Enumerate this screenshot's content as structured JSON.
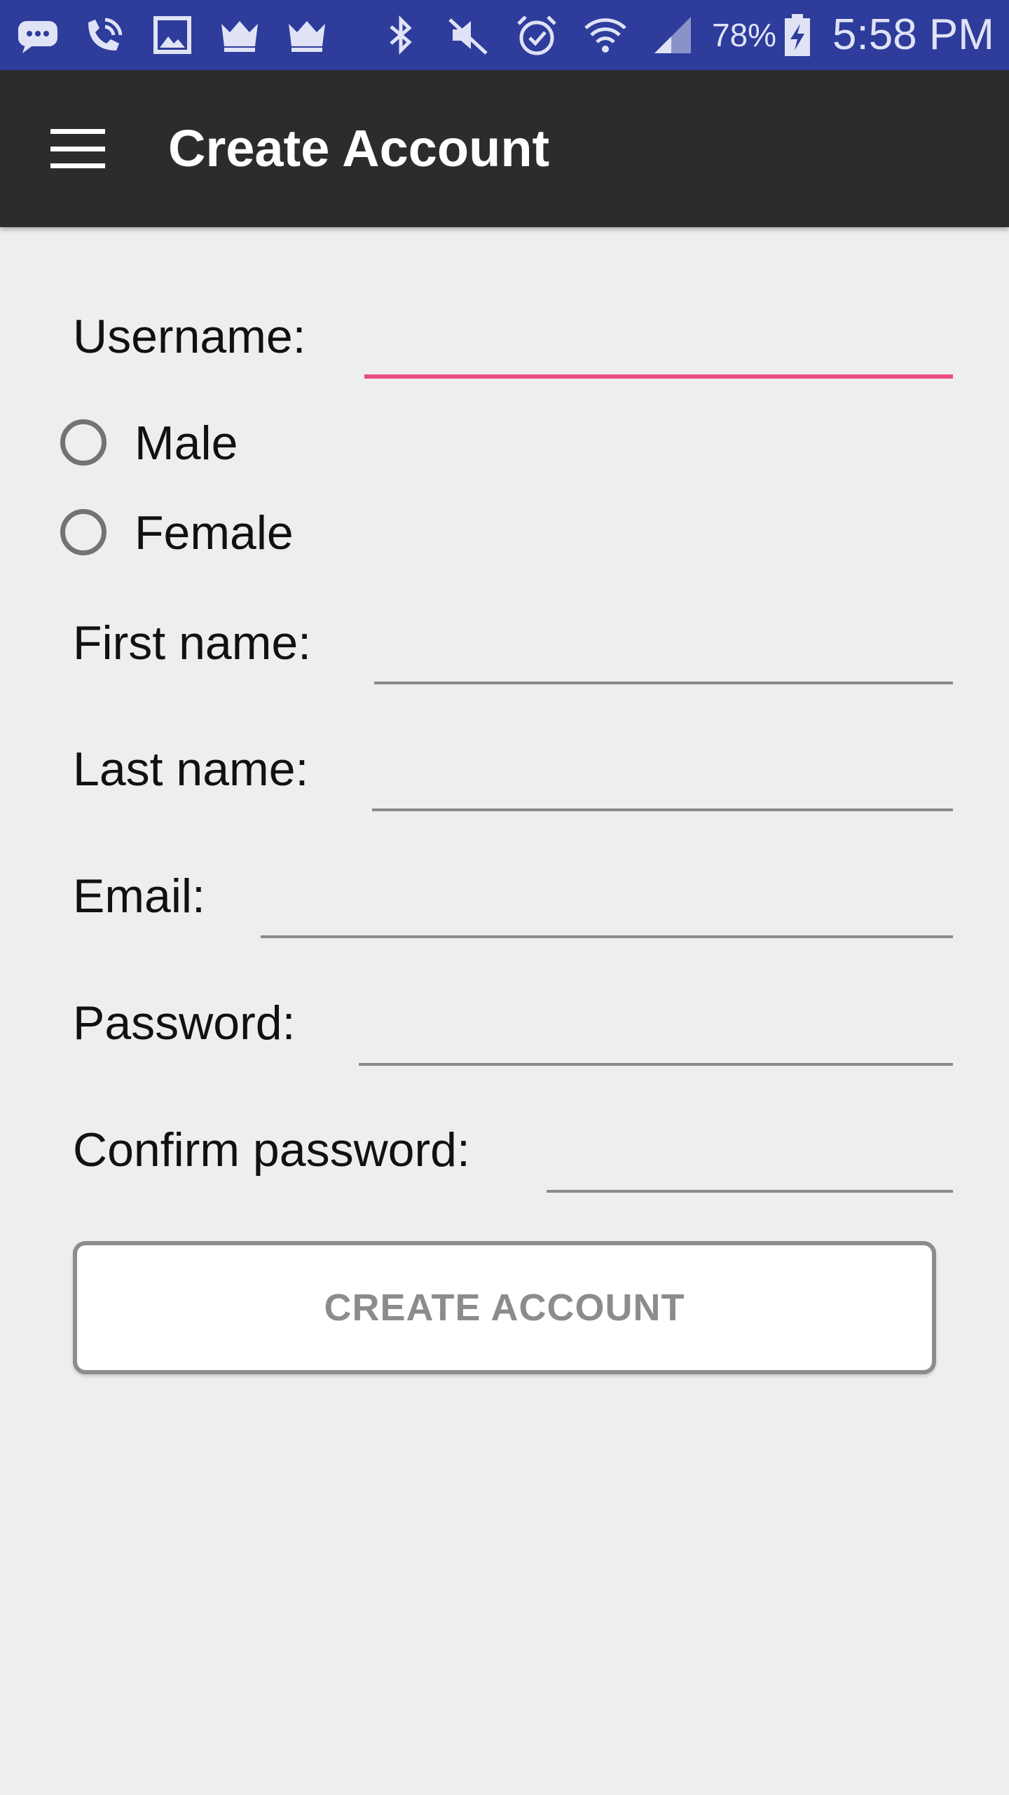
{
  "status_bar": {
    "battery_percent": "78%",
    "time": "5:58 PM",
    "icons": [
      "message-icon",
      "wifi-calling-icon",
      "image-icon",
      "crown-icon",
      "crown-icon",
      "bluetooth-icon",
      "mute-icon",
      "alarm-icon",
      "wifi-icon",
      "signal-icon",
      "battery-charging-icon"
    ]
  },
  "app_bar": {
    "title": "Create Account",
    "menu_icon": "hamburger-menu-icon"
  },
  "form": {
    "username_label": "Username:",
    "username_value": "",
    "gender": {
      "options": [
        "Male",
        "Female"
      ],
      "selected": null
    },
    "first_name_label": "First name:",
    "first_name_value": "",
    "last_name_label": "Last name:",
    "last_name_value": "",
    "email_label": "Email:",
    "email_value": "",
    "password_label": "Password:",
    "password_value": "",
    "confirm_password_label": "Confirm password:",
    "confirm_password_value": "",
    "submit_label": "CREATE ACCOUNT"
  },
  "colors": {
    "status_bar": "#2e3c9c",
    "app_bar": "#2c2c2c",
    "background": "#eeeeee",
    "focus_accent": "#ea4a82",
    "underline": "#8a8a8a"
  }
}
